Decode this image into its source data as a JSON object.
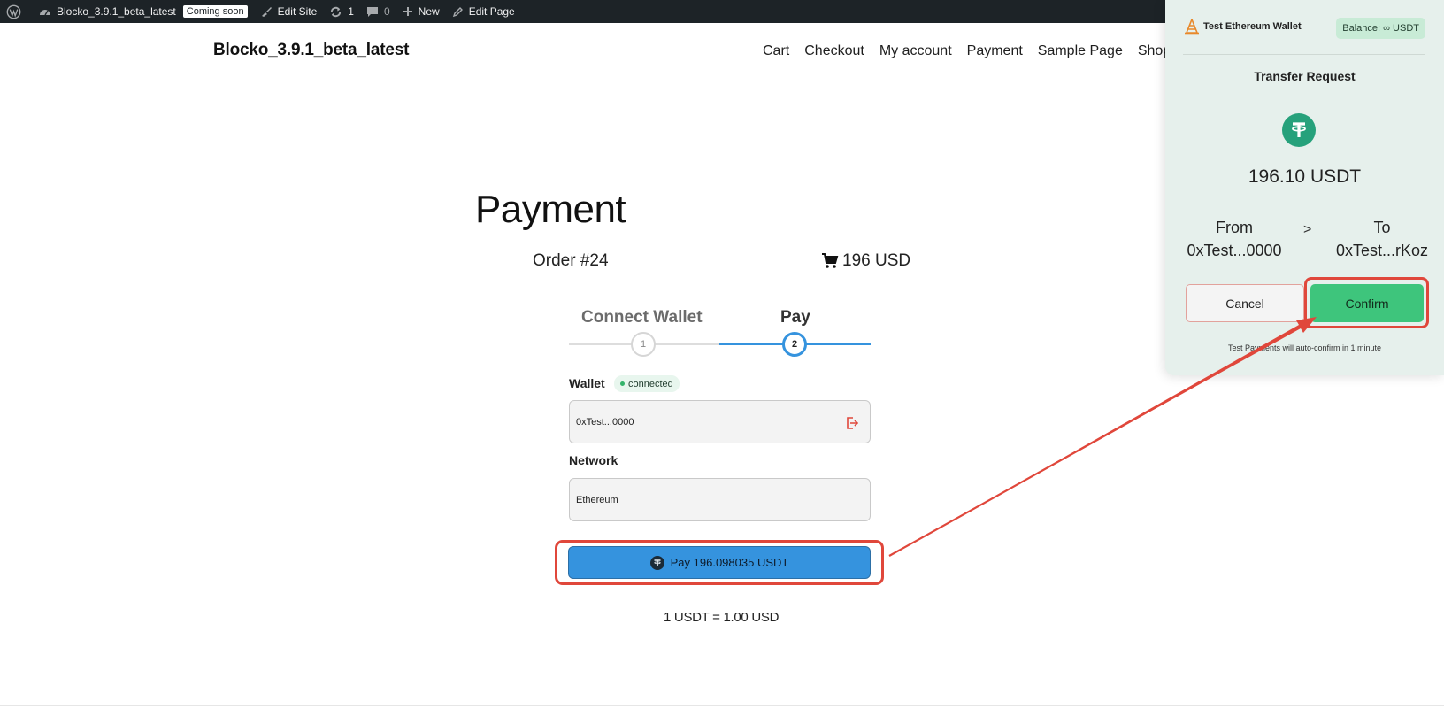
{
  "admin_bar": {
    "site_name": "Blocko_3.9.1_beta_latest",
    "coming_soon": "Coming soon",
    "edit_site": "Edit Site",
    "updates_count": "1",
    "comments_count": "0",
    "new_label": "New",
    "edit_page": "Edit Page"
  },
  "header": {
    "site_title": "Blocko_3.9.1_beta_latest",
    "nav": [
      "Cart",
      "Checkout",
      "My account",
      "Payment",
      "Sample Page",
      "Shop"
    ]
  },
  "payment": {
    "title": "Payment",
    "order_number": "Order #24",
    "order_total": "196 USD",
    "steps": [
      {
        "number": "1",
        "label": "Connect Wallet"
      },
      {
        "number": "2",
        "label": "Pay"
      }
    ],
    "wallet_label": "Wallet",
    "wallet_status": "connected",
    "wallet_address": "0xTest...0000",
    "network_label": "Network",
    "network_value": "Ethereum",
    "pay_button": "Pay 196.098035 USDT",
    "exchange_rate": "1 USDT = 1.00 USD"
  },
  "wallet_popup": {
    "wallet_name": "Test Ethereum Wallet",
    "balance": "Balance: ∞ USDT",
    "title": "Transfer Request",
    "amount": "196.10 USDT",
    "from_label": "From",
    "from_address": "0xTest...0000",
    "arrow": ">",
    "to_label": "To",
    "to_address": "0xTest...rKoz",
    "cancel_button": "Cancel",
    "confirm_button": "Confirm",
    "note": "Test Payments will auto-confirm in 1 minute"
  },
  "colors": {
    "admin_bar_bg": "#1d2327",
    "accent_blue": "#3593de",
    "confirm_green": "#3ec57c",
    "tether_green": "#26a17b",
    "annotation_red": "#e0473b",
    "popup_bg": "#e6f0ec"
  }
}
